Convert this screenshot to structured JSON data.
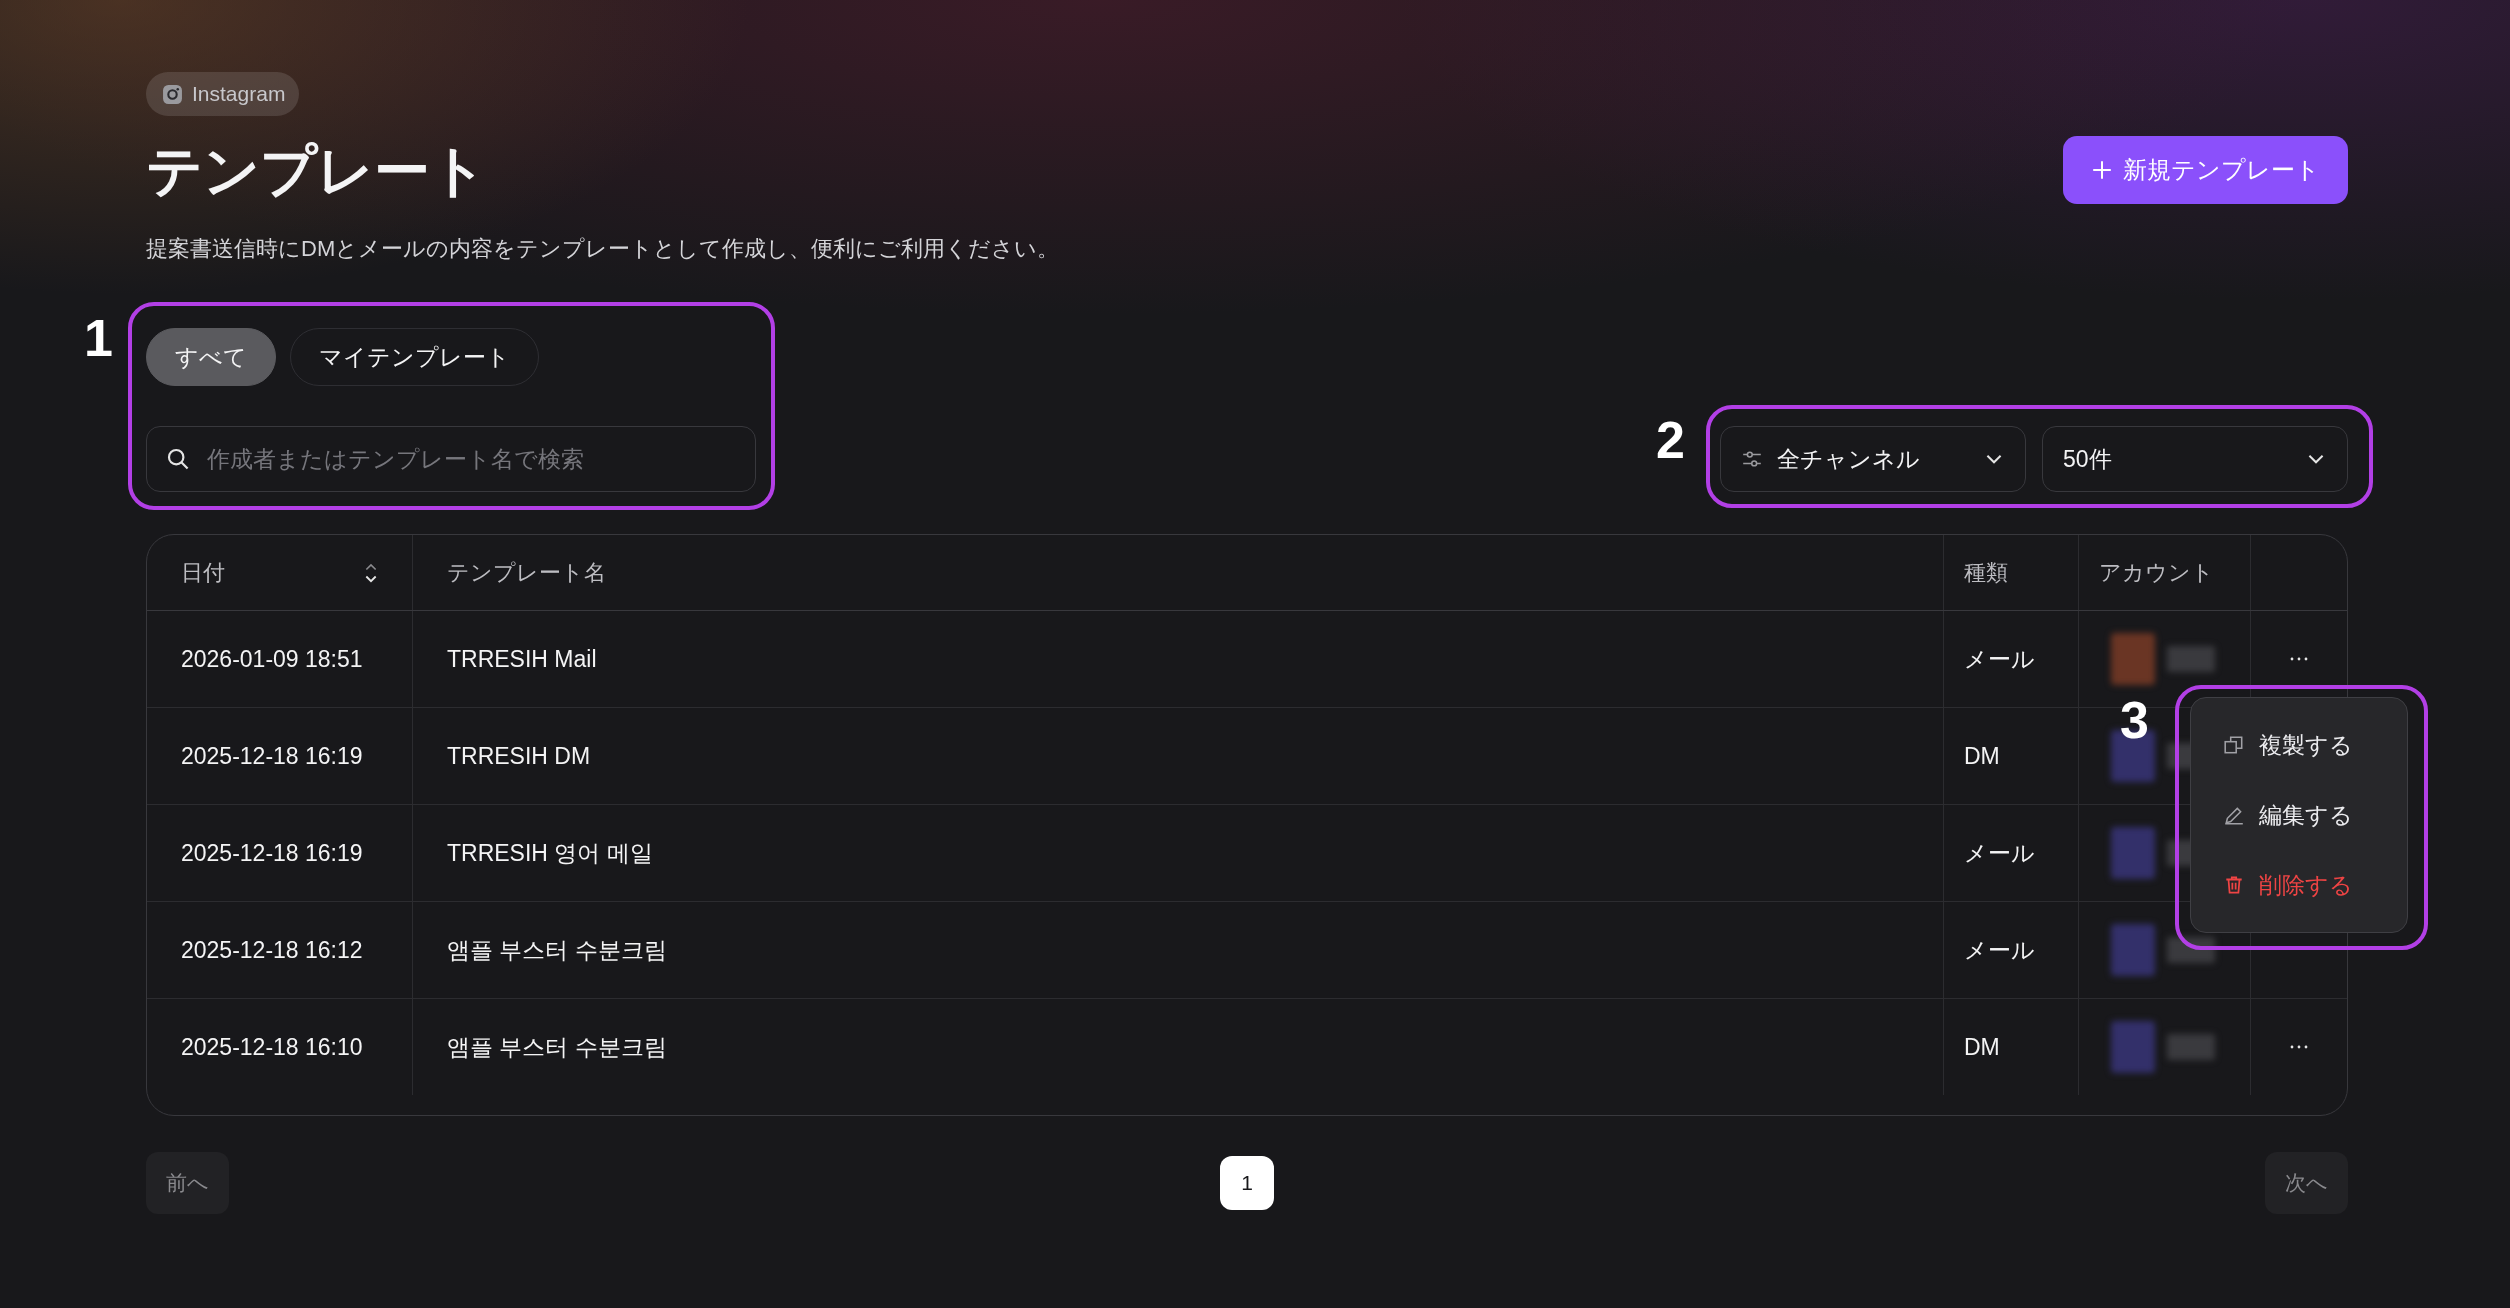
{
  "platform_badge": {
    "label": "Instagram"
  },
  "header": {
    "title": "テンプレート",
    "description": "提案書送信時にDMとメールの内容をテンプレートとして作成し、便利にご利用ください。",
    "new_button": "新規テンプレート"
  },
  "tabs": [
    {
      "label": "すべて",
      "selected": true
    },
    {
      "label": "マイテンプレート",
      "selected": false
    }
  ],
  "search": {
    "placeholder": "作成者またはテンプレート名で検索"
  },
  "filters": [
    {
      "kind": "channel",
      "label": "全チャンネル"
    },
    {
      "kind": "count",
      "label": "50件"
    }
  ],
  "table": {
    "columns": [
      {
        "label": "日付",
        "sortable": true
      },
      {
        "label": "テンプレート名",
        "sortable": false
      },
      {
        "label": "種類",
        "sortable": false
      },
      {
        "label": "アカウント",
        "sortable": false
      }
    ],
    "rows": [
      {
        "date": "2026-01-09 18:51",
        "name": "TRRESIH Mail",
        "type": "メール",
        "account": {
          "color": "#6a3524"
        },
        "actions_visible": true
      },
      {
        "date": "2025-12-18 16:19",
        "name": "TRRESIH DM",
        "type": "DM",
        "account": {
          "color": "#33306a"
        },
        "actions_visible": false
      },
      {
        "date": "2025-12-18 16:19",
        "name": "TRRESIH 영어 메일",
        "type": "メール",
        "account": {
          "color": "#33306a"
        },
        "actions_visible": false
      },
      {
        "date": "2025-12-18 16:12",
        "name": "앰플 부스터 수분크림",
        "type": "メール",
        "account": {
          "color": "#33306a"
        },
        "actions_visible": false
      },
      {
        "date": "2025-12-18 16:10",
        "name": "앰플 부스터 수분크림",
        "type": "DM",
        "account": {
          "color": "#33306a"
        },
        "actions_visible": true
      }
    ]
  },
  "row_menu": {
    "items": [
      {
        "kind": "duplicate",
        "label": "複製する"
      },
      {
        "kind": "edit",
        "label": "編集する"
      },
      {
        "kind": "delete",
        "label": "削除する"
      }
    ]
  },
  "pagination": {
    "previous": {
      "label": "前へ",
      "disabled": true
    },
    "pages": [
      {
        "label": "1",
        "selected": true
      }
    ],
    "next": {
      "label": "次へ",
      "disabled": true
    }
  },
  "annotations": [
    {
      "label": "1"
    },
    {
      "label": "2"
    },
    {
      "label": "3"
    }
  ]
}
